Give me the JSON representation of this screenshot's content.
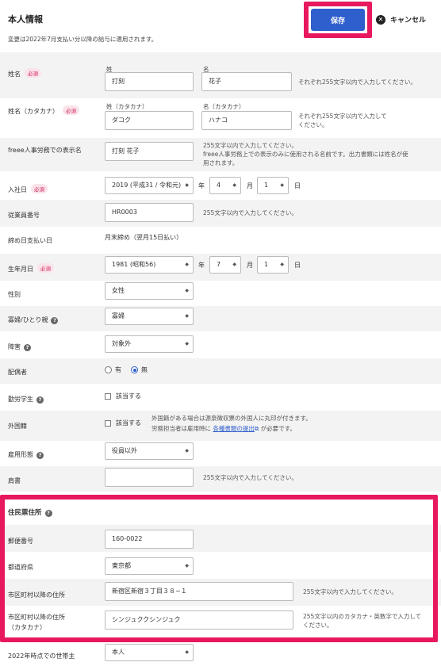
{
  "header": {
    "title": "本人情報",
    "notice": "変更は2022年7月支払い分以降の給与に適用されます。",
    "save_label": "保存",
    "cancel_label": "キャンセル"
  },
  "required_badge": "必須",
  "rows": {
    "name": {
      "label": "姓名",
      "sub_last": "姓",
      "sub_first": "名",
      "last_value": "打刻",
      "first_value": "花子",
      "hint": "それぞれ255文字以内で入力してください。"
    },
    "kana": {
      "label": "姓名（カタカナ）",
      "sub_last": "姓（カタカナ）",
      "sub_first": "名（カタカナ）",
      "last_value": "ダコク",
      "first_value": "ハナコ",
      "hint_line1": "それぞれ255文字以内で入力して",
      "hint_line2": "ください。"
    },
    "display": {
      "label": "freee人事労務での表示名",
      "value": "打刻 花子",
      "hint_line1": "255文字以内で入力してください。",
      "hint_line2": "freee人事労務上での表示のみに使用される名前です。出力書類には姓名が使",
      "hint_line3": "用されます。"
    },
    "hire": {
      "label": "入社日",
      "year": "2019 (平成31 / 令和元)",
      "month": "4",
      "day": "1",
      "year_unit": "年",
      "month_unit": "月",
      "day_unit": "日"
    },
    "employee_no": {
      "label": "従業員番号",
      "value": "HR0003",
      "hint": "255文字以内で入力してください。"
    },
    "closing": {
      "label": "締め日支払い日",
      "value": "月末締め（翌月15日払い）"
    },
    "birth": {
      "label": "生年月日",
      "year": "1981 (昭和56)",
      "month": "7",
      "day": "1",
      "year_unit": "年",
      "month_unit": "月",
      "day_unit": "日"
    },
    "gender": {
      "label": "性別",
      "value": "女性"
    },
    "widow": {
      "label": "寡婦/ひとり親",
      "value": "寡婦"
    },
    "disability": {
      "label": "障害",
      "value": "対象外"
    },
    "spouse": {
      "label": "配偶者",
      "option_yes": "有",
      "option_no": "無"
    },
    "student": {
      "label": "勤労学生",
      "check_label": "該当する"
    },
    "foreign": {
      "label": "外国籍",
      "check_label": "該当する",
      "hint_line1": "外国籍がある場合は源泉徴収票の外国人に丸印が付きます。",
      "hint_line2_pre": "労務担当者は雇用時に",
      "hint_link": "各種書類の提出",
      "hint_line2_post": "が必要です。"
    },
    "employment": {
      "label": "雇用形態",
      "value": "役員以外"
    },
    "job_title": {
      "label": "肩書",
      "value": "",
      "hint": "255文字以内で入力してください。"
    }
  },
  "address": {
    "section_title": "住民票住所",
    "postal": {
      "label": "郵便番号",
      "value": "160-0022"
    },
    "prefecture": {
      "label": "都道府県",
      "value": "東京都"
    },
    "street": {
      "label": "市区町村以降の住所",
      "value": "新宿区新宿３丁目３８−１",
      "hint": "255文字以内で入力してください。"
    },
    "street_kana": {
      "label_line1": "市区町村以降の住所",
      "label_line2": "（カタカナ）",
      "value": "シンジュククシンジュク",
      "hint_line1": "255文字以内のカタカナ・英数字で入力して",
      "hint_line2": "ください。"
    }
  },
  "householder": {
    "label": "2022年時点での世帯主",
    "value": "本人"
  },
  "colors": {
    "accent": "#2f5fcc",
    "highlight": "#e8185f",
    "required": "#d0215a",
    "row_shade": "#f3f3f3"
  }
}
